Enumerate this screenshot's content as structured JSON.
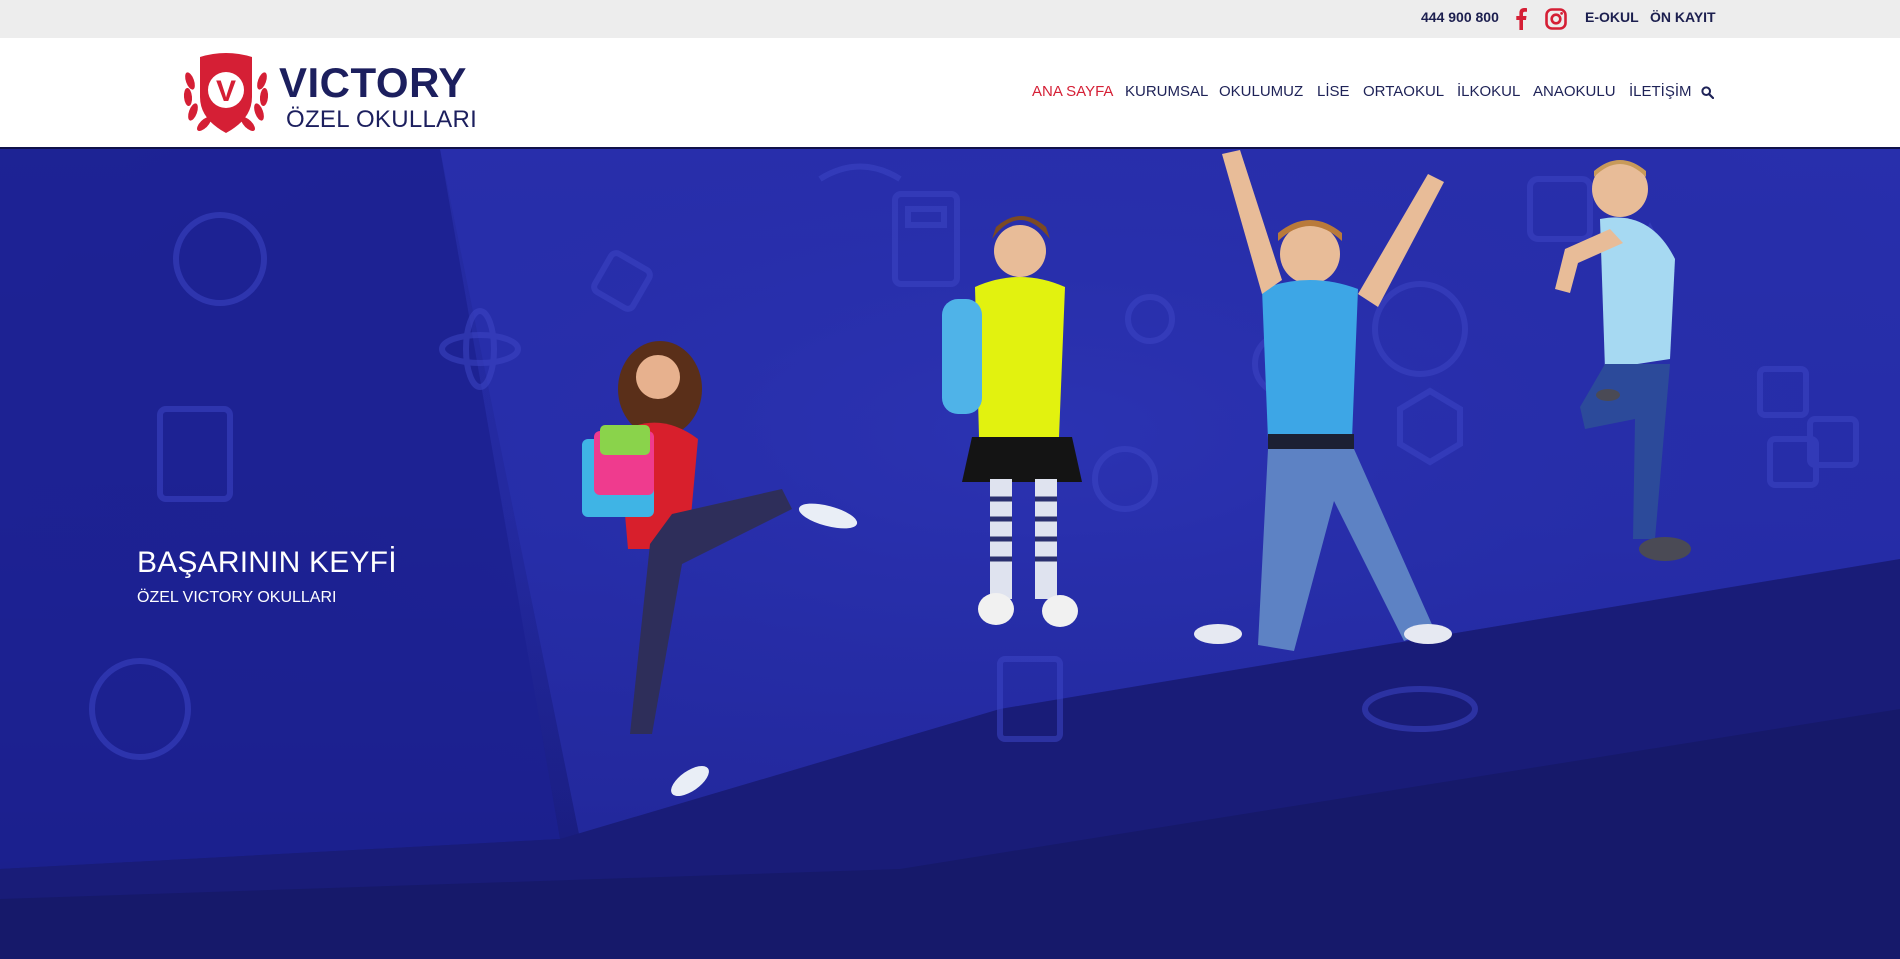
{
  "topbar": {
    "phone": "444 900 800",
    "facebook_icon": "facebook-icon",
    "instagram_icon": "instagram-icon",
    "links": [
      "E-OKUL",
      "ÖN KAYIT"
    ]
  },
  "logo": {
    "badge_letter": "V",
    "title": "VICTORY",
    "subtitle": "ÖZEL OKULLARI"
  },
  "nav": {
    "items": [
      "ANA SAYFA",
      "KURUMSAL",
      "OKULUMUZ",
      "LİSE",
      "ORTAOKUL",
      "İLKOKUL",
      "ANAOKULU",
      "İLETİŞİM"
    ],
    "active": "ANA SAYFA",
    "search_icon": "search-icon"
  },
  "hero": {
    "title": "BAŞARININ KEYFİ",
    "subtitle": "ÖZEL VICTORY OKULLARI"
  },
  "colors": {
    "brand_navy": "#1c1f5e",
    "accent_red": "#d51f35",
    "hero_blue": "#2228a0",
    "topbar_bg": "#ededed"
  }
}
